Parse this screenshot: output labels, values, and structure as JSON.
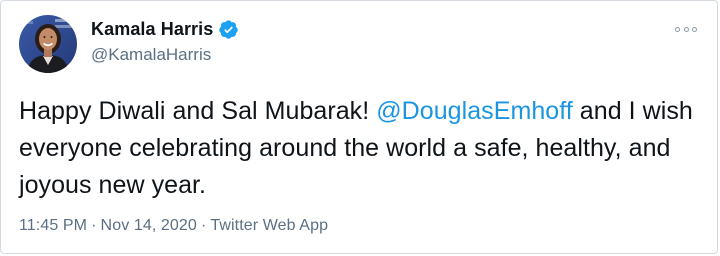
{
  "colors": {
    "accent": "#1b95e0",
    "verified_badge": "#1da1f2",
    "secondary_text": "#5b7083",
    "primary_text": "#0f1419"
  },
  "author": {
    "name": "Kamala Harris",
    "handle": "@KamalaHarris",
    "verified_icon": "verified-badge-icon",
    "avatar_icon": "profile-photo"
  },
  "more_icon": "more-options-icon",
  "tweet": {
    "text_before": "Happy Diwali and Sal Mubarak! ",
    "mention": "@DouglasEmhoff",
    "text_after": " and I wish everyone celebrating around the world a safe, healthy, and joyous new year."
  },
  "meta": {
    "time": "11:45 PM",
    "separator": "·",
    "date": "Nov 14, 2020",
    "source": "Twitter Web App"
  }
}
